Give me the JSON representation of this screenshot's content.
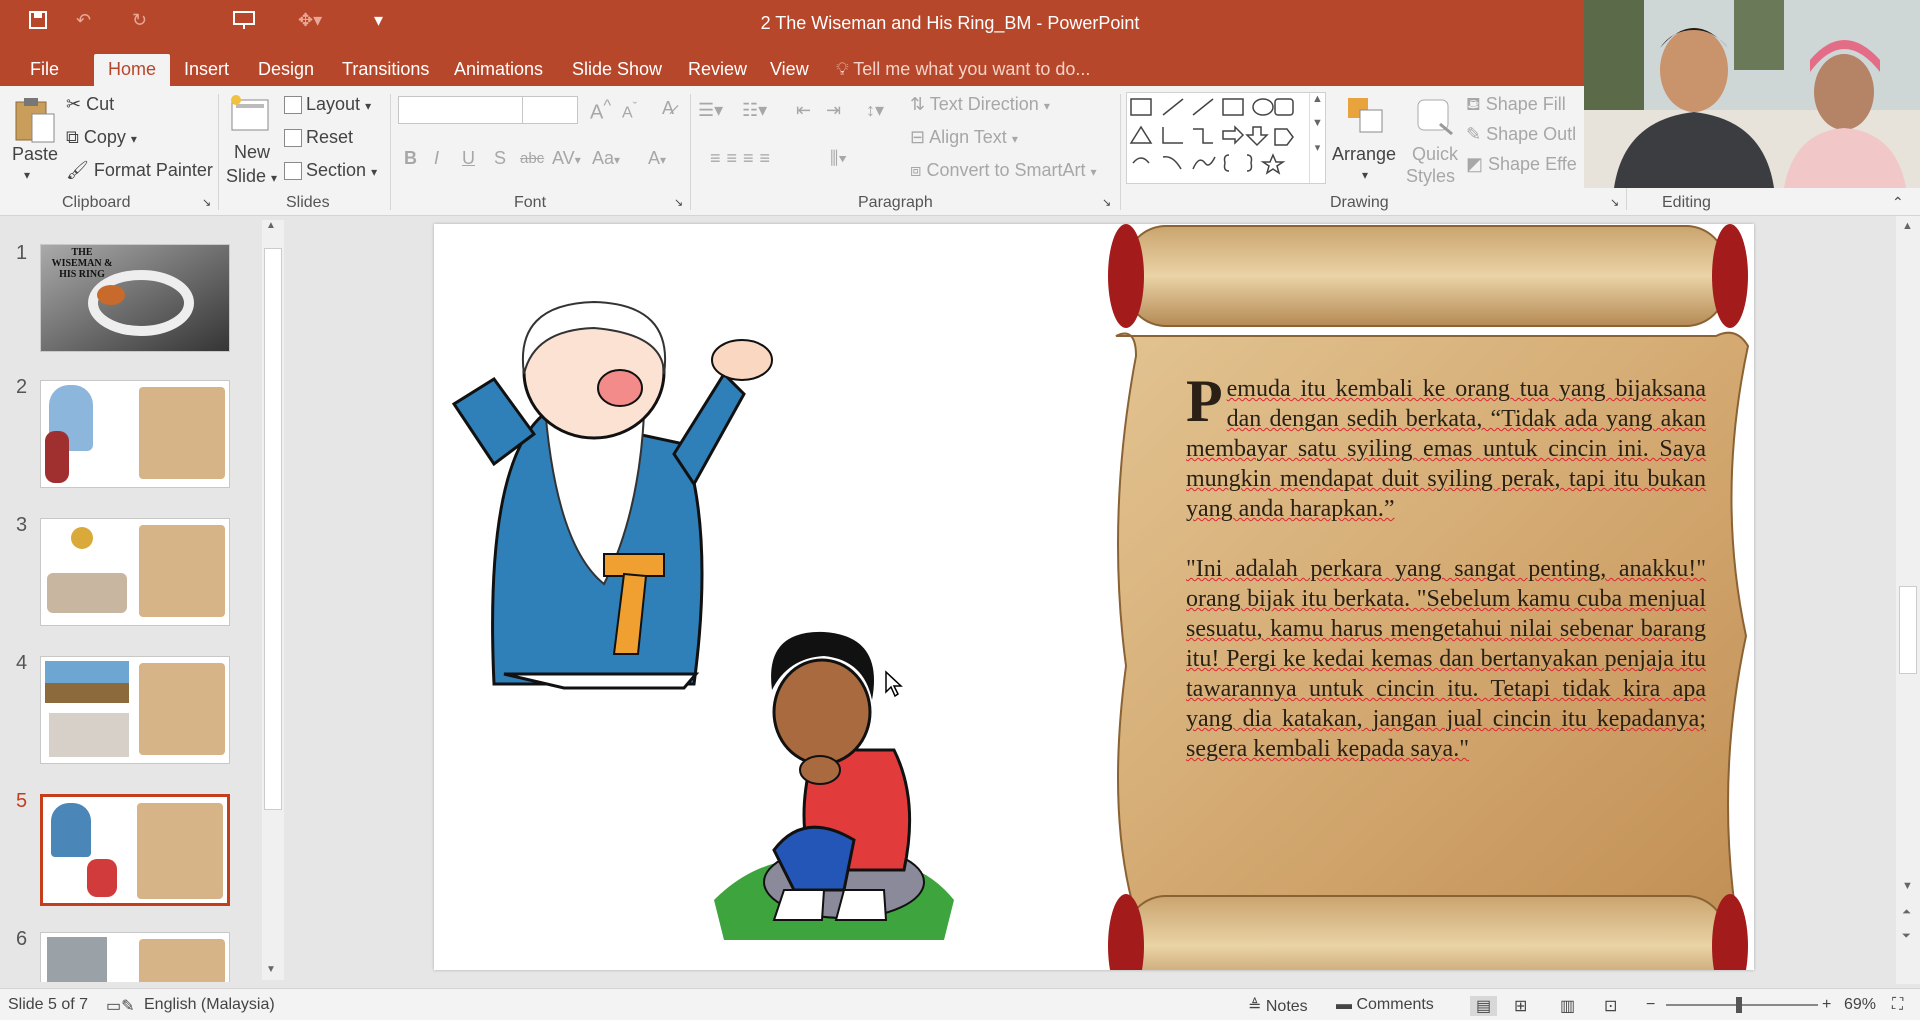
{
  "window": {
    "title": "2 The Wiseman and His Ring_BM - PowerPoint"
  },
  "tabs": [
    "File",
    "Home",
    "Insert",
    "Design",
    "Transitions",
    "Animations",
    "Slide Show",
    "Review",
    "View"
  ],
  "tell_me": "Tell me what you want to do...",
  "ribbon": {
    "clipboard": {
      "paste": "Paste",
      "cut": "Cut",
      "copy": "Copy",
      "format_painter": "Format Painter",
      "label": "Clipboard"
    },
    "slides": {
      "new_slide_line1": "New",
      "new_slide_line2": "Slide",
      "layout": "Layout",
      "reset": "Reset",
      "section": "Section",
      "label": "Slides"
    },
    "font": {
      "label": "Font",
      "bold": "B",
      "italic": "I",
      "underline": "U",
      "shadow": "S",
      "strike": "abc",
      "spacing": "AV",
      "case": "Aa",
      "color": "A",
      "grow": "A",
      "shrink": "A"
    },
    "paragraph": {
      "text_direction": "Text Direction",
      "align_text": "Align Text",
      "convert_smartart": "Convert to SmartArt",
      "label": "Paragraph"
    },
    "drawing": {
      "arrange": "Arrange",
      "quick_styles_line1": "Quick",
      "quick_styles_line2": "Styles",
      "shape_fill": "Shape Fill",
      "shape_outline": "Shape Outl",
      "shape_effects": "Shape Effe",
      "label": "Drawing"
    },
    "editing": {
      "label": "Editing"
    }
  },
  "thumbnails": [
    {
      "num": "1",
      "title_text": "THE WISEMAN & HIS RING"
    },
    {
      "num": "2"
    },
    {
      "num": "3"
    },
    {
      "num": "4"
    },
    {
      "num": "5"
    },
    {
      "num": "6"
    }
  ],
  "slide": {
    "drop_cap": "P",
    "para1_rest": "emuda itu kembali ke orang tua yang bijaksana dan dengan sedih berkata, “Tidak ada yang akan membayar satu syiling emas untuk cincin ini. Saya mungkin mendapat duit syiling perak, tapi itu bukan yang anda harapkan.”",
    "para2": "\"Ini adalah perkara yang sangat penting, anakku!\" orang bijak itu berkata. \"Sebelum kamu cuba menjual sesuatu, kamu harus mengetahui nilai sebenar barang itu! Pergi ke kedai kemas dan bertanyakan penjaja itu tawarannya untuk cincin itu. Tetapi tidak kira apa yang dia katakan, jangan jual cincin itu kepadanya; segera kembali kepada saya.\""
  },
  "status": {
    "slide_info": "Slide 5 of 7",
    "language": "English (Malaysia)",
    "notes": "Notes",
    "comments": "Comments",
    "zoom": "69%"
  },
  "colors": {
    "accent": "#b7472a",
    "selected_thumb": "#c43e1c",
    "scroll_paper": "#d7b488"
  }
}
